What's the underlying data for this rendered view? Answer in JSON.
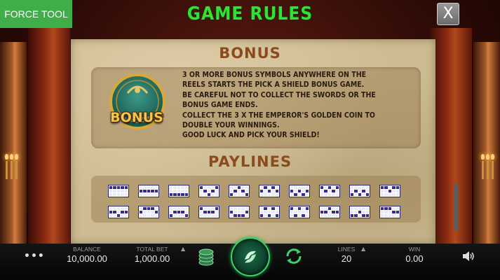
{
  "header": {
    "force_tool": "FORCE TOOL",
    "title": "GAME RULES",
    "close_label": "X"
  },
  "bonus": {
    "title": "BONUS",
    "badge_label": "BONUS",
    "lines": [
      "3 OR MORE BONUS SYMBOLS ANYWHERE ON THE",
      "REELS STARTS THE PICK A SHIELD BONUS GAME.",
      "BE CAREFUL NOT TO COLLECT THE SWORDS OR THE",
      "BONUS GAME ENDS.",
      "COLLECT THE 3 X THE EMPEROR'S GOLDEN COIN TO",
      "DOUBLE YOUR WINNINGS.",
      "GOOD LUCK AND PICK YOUR SHIELD!"
    ]
  },
  "paylines": {
    "title": "PAYLINES",
    "patterns": [
      [
        [
          1,
          1,
          1,
          1,
          1
        ],
        [
          0,
          0,
          0,
          0,
          0
        ],
        [
          0,
          0,
          0,
          0,
          0
        ]
      ],
      [
        [
          0,
          0,
          0,
          0,
          0
        ],
        [
          1,
          1,
          1,
          1,
          1
        ],
        [
          0,
          0,
          0,
          0,
          0
        ]
      ],
      [
        [
          0,
          0,
          0,
          0,
          0
        ],
        [
          0,
          0,
          0,
          0,
          0
        ],
        [
          1,
          1,
          1,
          1,
          1
        ]
      ],
      [
        [
          1,
          0,
          0,
          0,
          1
        ],
        [
          0,
          1,
          0,
          1,
          0
        ],
        [
          0,
          0,
          1,
          0,
          0
        ]
      ],
      [
        [
          0,
          0,
          1,
          0,
          0
        ],
        [
          0,
          1,
          0,
          1,
          0
        ],
        [
          1,
          0,
          0,
          0,
          1
        ]
      ],
      [
        [
          0,
          1,
          0,
          1,
          0
        ],
        [
          1,
          0,
          1,
          0,
          1
        ],
        [
          0,
          0,
          0,
          0,
          0
        ]
      ],
      [
        [
          0,
          0,
          0,
          0,
          0
        ],
        [
          1,
          0,
          1,
          0,
          1
        ],
        [
          0,
          1,
          0,
          1,
          0
        ]
      ],
      [
        [
          1,
          0,
          1,
          0,
          1
        ],
        [
          0,
          1,
          0,
          1,
          0
        ],
        [
          0,
          0,
          0,
          0,
          0
        ]
      ],
      [
        [
          0,
          0,
          0,
          0,
          0
        ],
        [
          0,
          1,
          0,
          1,
          0
        ],
        [
          1,
          0,
          1,
          0,
          1
        ]
      ],
      [
        [
          1,
          1,
          0,
          1,
          1
        ],
        [
          0,
          0,
          1,
          0,
          0
        ],
        [
          0,
          0,
          0,
          0,
          0
        ]
      ],
      [
        [
          0,
          0,
          0,
          0,
          0
        ],
        [
          1,
          1,
          0,
          1,
          1
        ],
        [
          0,
          0,
          1,
          0,
          0
        ]
      ],
      [
        [
          0,
          1,
          1,
          1,
          0
        ],
        [
          1,
          0,
          0,
          0,
          1
        ],
        [
          0,
          0,
          0,
          0,
          0
        ]
      ],
      [
        [
          0,
          0,
          0,
          0,
          0
        ],
        [
          0,
          1,
          1,
          1,
          0
        ],
        [
          1,
          0,
          0,
          0,
          1
        ]
      ],
      [
        [
          1,
          0,
          0,
          0,
          1
        ],
        [
          0,
          1,
          1,
          1,
          0
        ],
        [
          0,
          0,
          0,
          0,
          0
        ]
      ],
      [
        [
          0,
          0,
          0,
          0,
          0
        ],
        [
          1,
          0,
          0,
          0,
          1
        ],
        [
          0,
          1,
          1,
          1,
          0
        ]
      ],
      [
        [
          0,
          1,
          0,
          1,
          0
        ],
        [
          0,
          0,
          0,
          0,
          0
        ],
        [
          1,
          0,
          1,
          0,
          1
        ]
      ],
      [
        [
          1,
          0,
          1,
          0,
          1
        ],
        [
          0,
          0,
          0,
          0,
          0
        ],
        [
          0,
          1,
          0,
          1,
          0
        ]
      ],
      [
        [
          0,
          0,
          1,
          0,
          0
        ],
        [
          1,
          1,
          0,
          1,
          1
        ],
        [
          0,
          0,
          0,
          0,
          0
        ]
      ],
      [
        [
          0,
          0,
          0,
          0,
          0
        ],
        [
          0,
          0,
          1,
          0,
          0
        ],
        [
          1,
          1,
          0,
          1,
          1
        ]
      ],
      [
        [
          1,
          1,
          1,
          0,
          0
        ],
        [
          0,
          0,
          0,
          1,
          1
        ],
        [
          0,
          0,
          0,
          0,
          0
        ]
      ]
    ]
  },
  "footer": {
    "menu_icon": "more-dots-icon",
    "balance_label": "BALANCE",
    "balance_value": "10,000.00",
    "total_bet_label": "TOTAL BET",
    "total_bet_value": "1,000.00",
    "lines_label": "LINES",
    "lines_value": "20",
    "win_label": "WIN",
    "win_value": "0.00"
  },
  "colors": {
    "title_green": "#2fe234",
    "force_tool_green": "#3fae49",
    "panel_parchment": "#cdbb92",
    "heading_brown": "#8a4c1e",
    "payline_purple": "#3b2a8a"
  }
}
